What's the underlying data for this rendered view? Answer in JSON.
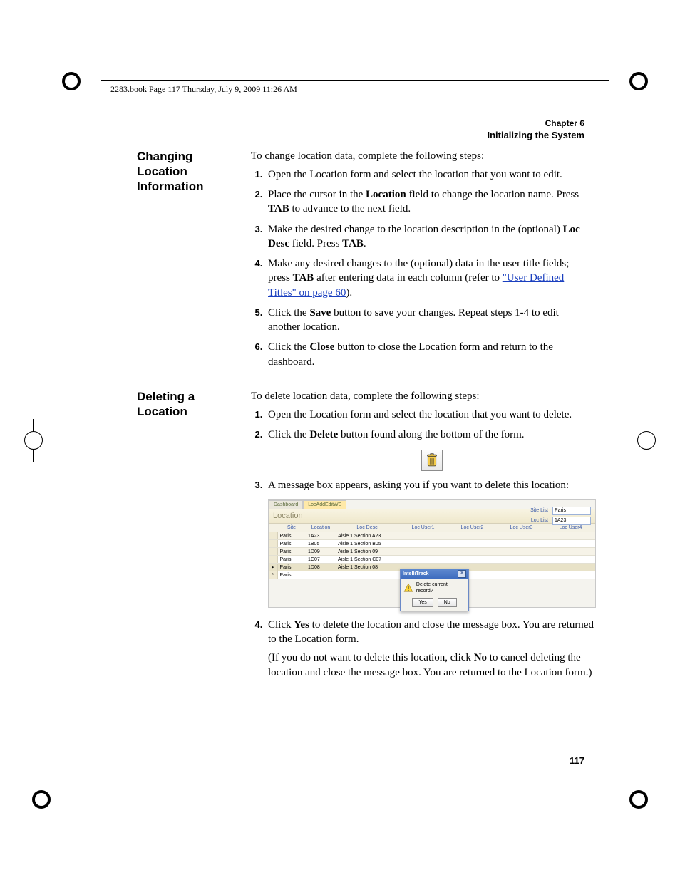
{
  "book_header": "2283.book  Page 117  Thursday, July 9, 2009  11:26 AM",
  "chapter": {
    "line1": "Chapter 6",
    "line2": "Initializing the System"
  },
  "page_number": "117",
  "sec1": {
    "heading": "Changing Location Information",
    "intro": "To change location data, complete the following steps:",
    "steps": {
      "s1": "Open the Location form and select the location that you want to edit.",
      "s2a": "Place the cursor in the ",
      "s2b": "Location",
      "s2c": " field to change the location name. Press ",
      "s2d": "TAB",
      "s2e": " to advance to the next field.",
      "s3a": "Make the desired change to the location description in the (optional) ",
      "s3b": "Loc Desc",
      "s3c": " field. Press ",
      "s3d": "TAB",
      "s3e": ".",
      "s4a": "Make any desired changes to the (optional) data in the user title fields; press ",
      "s4b": "TAB",
      "s4c": " after entering data in each column (refer to ",
      "s4link": "\"User Defined Titles\" on page 60",
      "s4d": ").",
      "s5a": "Click the ",
      "s5b": "Save",
      "s5c": " button to save your changes. Repeat steps 1-4 to edit another location.",
      "s6a": "Click the ",
      "s6b": "Close",
      "s6c": " button to close the Location form and return to the dashboard."
    }
  },
  "sec2": {
    "heading": "Deleting a Location",
    "intro": "To delete location data, complete the following steps:",
    "steps": {
      "s1": "Open the Location form and select the location that you want to delete.",
      "s2a": "Click the ",
      "s2b": "Delete",
      "s2c": " button found along the bottom of the form.",
      "s3": "A message box appears, asking you if you want to delete this location:",
      "s4a": "Click ",
      "s4b": "Yes",
      "s4c": " to delete the location and close the message box. You are returned to the Location form.",
      "s4p2a": "(If you do not want to delete this location, click ",
      "s4p2b": "No",
      "s4p2c": " to cancel deleting the location and close the message box. You are returned to the Location form.)"
    }
  },
  "screenshot": {
    "tabs": {
      "dashboard": "Dashboard",
      "active": "LocAddEditWS"
    },
    "title": "Location",
    "site_list_label": "Site List",
    "site_list_value": "Paris",
    "loc_list_label": "Loc List",
    "loc_list_value": "1A23",
    "columns": {
      "c0": "",
      "c1": "Site",
      "c2": "Location",
      "c3": "Loc Desc",
      "c4": "Loc User1",
      "c5": "Loc User2",
      "c6": "Loc User3",
      "c7": "Loc User4"
    },
    "rows": [
      {
        "site": "Paris",
        "loc": "1A23",
        "desc": "Aisle 1 Section A23"
      },
      {
        "site": "Paris",
        "loc": "1B05",
        "desc": "Aisle 1 Section B05"
      },
      {
        "site": "Paris",
        "loc": "1D09",
        "desc": "Aisle 1 Section 09"
      },
      {
        "site": "Paris",
        "loc": "1C07",
        "desc": "Aisle 1 Section C07"
      },
      {
        "site": "Paris",
        "loc": "1D08",
        "desc": "Aisle 1 Section 08"
      },
      {
        "site": "Paris",
        "loc": "",
        "desc": ""
      }
    ],
    "dialog": {
      "title": "IntelliTrack",
      "message": "Delete current record?",
      "yes": "Yes",
      "no": "No"
    }
  }
}
